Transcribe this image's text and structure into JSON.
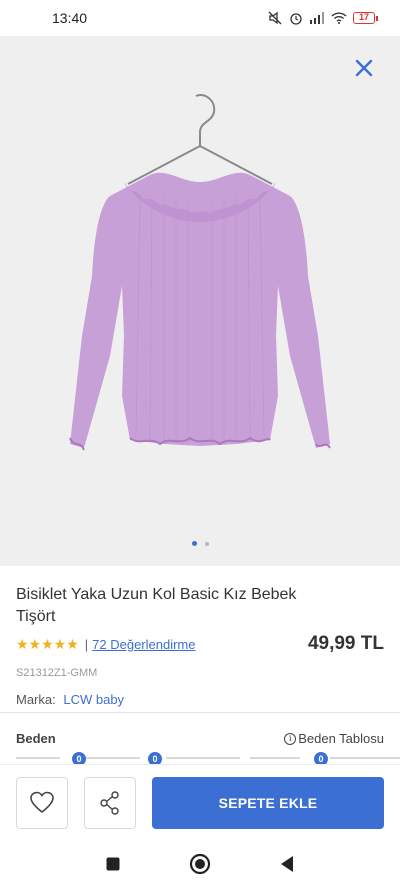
{
  "status": {
    "time": "13:40",
    "battery": "17"
  },
  "product": {
    "title": "Bisiklet Yaka Uzun Kol Basic Kız Bebek Tişört",
    "stars": "★★★★★",
    "separator": "|",
    "reviews": "72 Değerlendirme",
    "price": "49,99 TL",
    "sku": "S21312Z1-GMM",
    "brand_label": "Marka:",
    "brand_name": "LCW baby",
    "rating": 5,
    "image_index": 1,
    "image_count": 2
  },
  "size": {
    "label": "Beden",
    "table_link": "Beden Tablosu",
    "info_glyph": "i",
    "badges": [
      "0",
      "0",
      "0"
    ]
  },
  "actions": {
    "add_to_cart": "SEPETE EKLE"
  },
  "colors": {
    "accent": "#3b6fd4",
    "star": "#f2b01e",
    "hero_bg": "#efeff0",
    "garment": "#c8a0d8"
  },
  "icons": {
    "close": "close-icon",
    "favorite": "heart-icon",
    "share": "share-icon",
    "nav_recents": "square-icon",
    "nav_home": "circle-icon",
    "nav_back": "triangle-back-icon"
  }
}
